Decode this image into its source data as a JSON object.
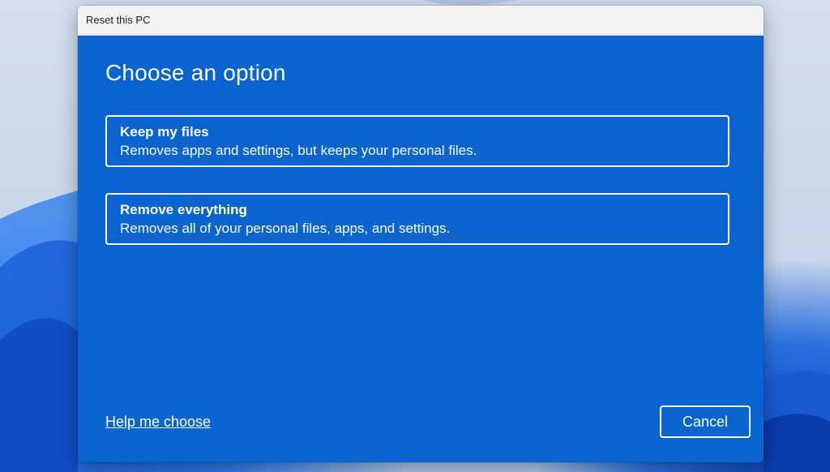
{
  "window": {
    "title": "Reset this PC"
  },
  "page": {
    "heading": "Choose an option"
  },
  "options": [
    {
      "title": "Keep my files",
      "description": "Removes apps and settings, but keeps your personal files."
    },
    {
      "title": "Remove everything",
      "description": "Removes all of your personal files, apps, and settings."
    }
  ],
  "footer": {
    "help_link": "Help me choose",
    "cancel_label": "Cancel"
  },
  "colors": {
    "dialog_background": "#0a64cf",
    "titlebar_background": "#f3f3f3",
    "text": "#ffffff"
  }
}
